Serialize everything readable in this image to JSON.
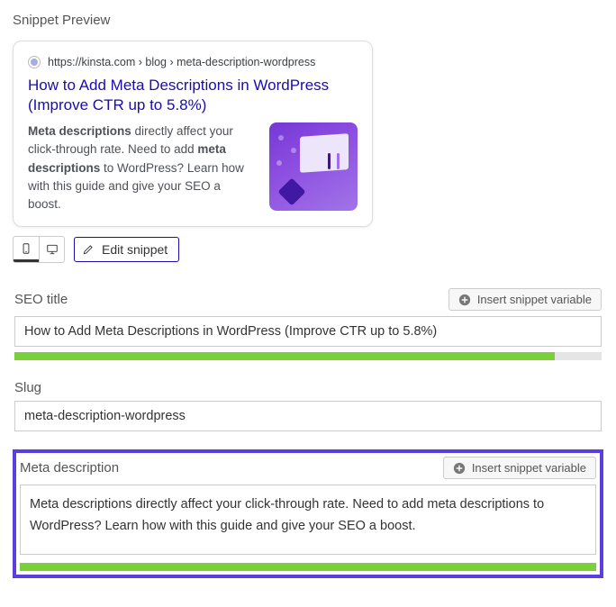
{
  "header": {
    "title": "Snippet Preview"
  },
  "preview": {
    "url": "https://kinsta.com › blog › meta-description-wordpress",
    "title": "How to Add Meta Descriptions in WordPress (Improve CTR up to 5.8%)",
    "desc_prefix_bold": "Meta descriptions",
    "desc_part1": " directly affect your click-through rate. Need to add ",
    "desc_mid_bold": "meta descriptions",
    "desc_part2": " to WordPress? Learn how with this guide and give your SEO a boost."
  },
  "toolbar": {
    "mobile_icon": "mobile",
    "desktop_icon": "desktop",
    "edit_label": "Edit snippet"
  },
  "seo_title": {
    "label": "SEO title",
    "insert_label": "Insert snippet variable",
    "value": "How to Add Meta Descriptions in WordPress (Improve CTR up to 5.8%)",
    "progress_pct": "92%"
  },
  "slug": {
    "label": "Slug",
    "value": "meta-description-wordpress"
  },
  "meta_desc": {
    "label": "Meta description",
    "insert_label": "Insert snippet variable",
    "value": "Meta descriptions directly affect your click-through rate. Need to add meta descriptions to WordPress? Learn how with this guide and give your SEO a boost.",
    "progress_pct": "100%"
  }
}
